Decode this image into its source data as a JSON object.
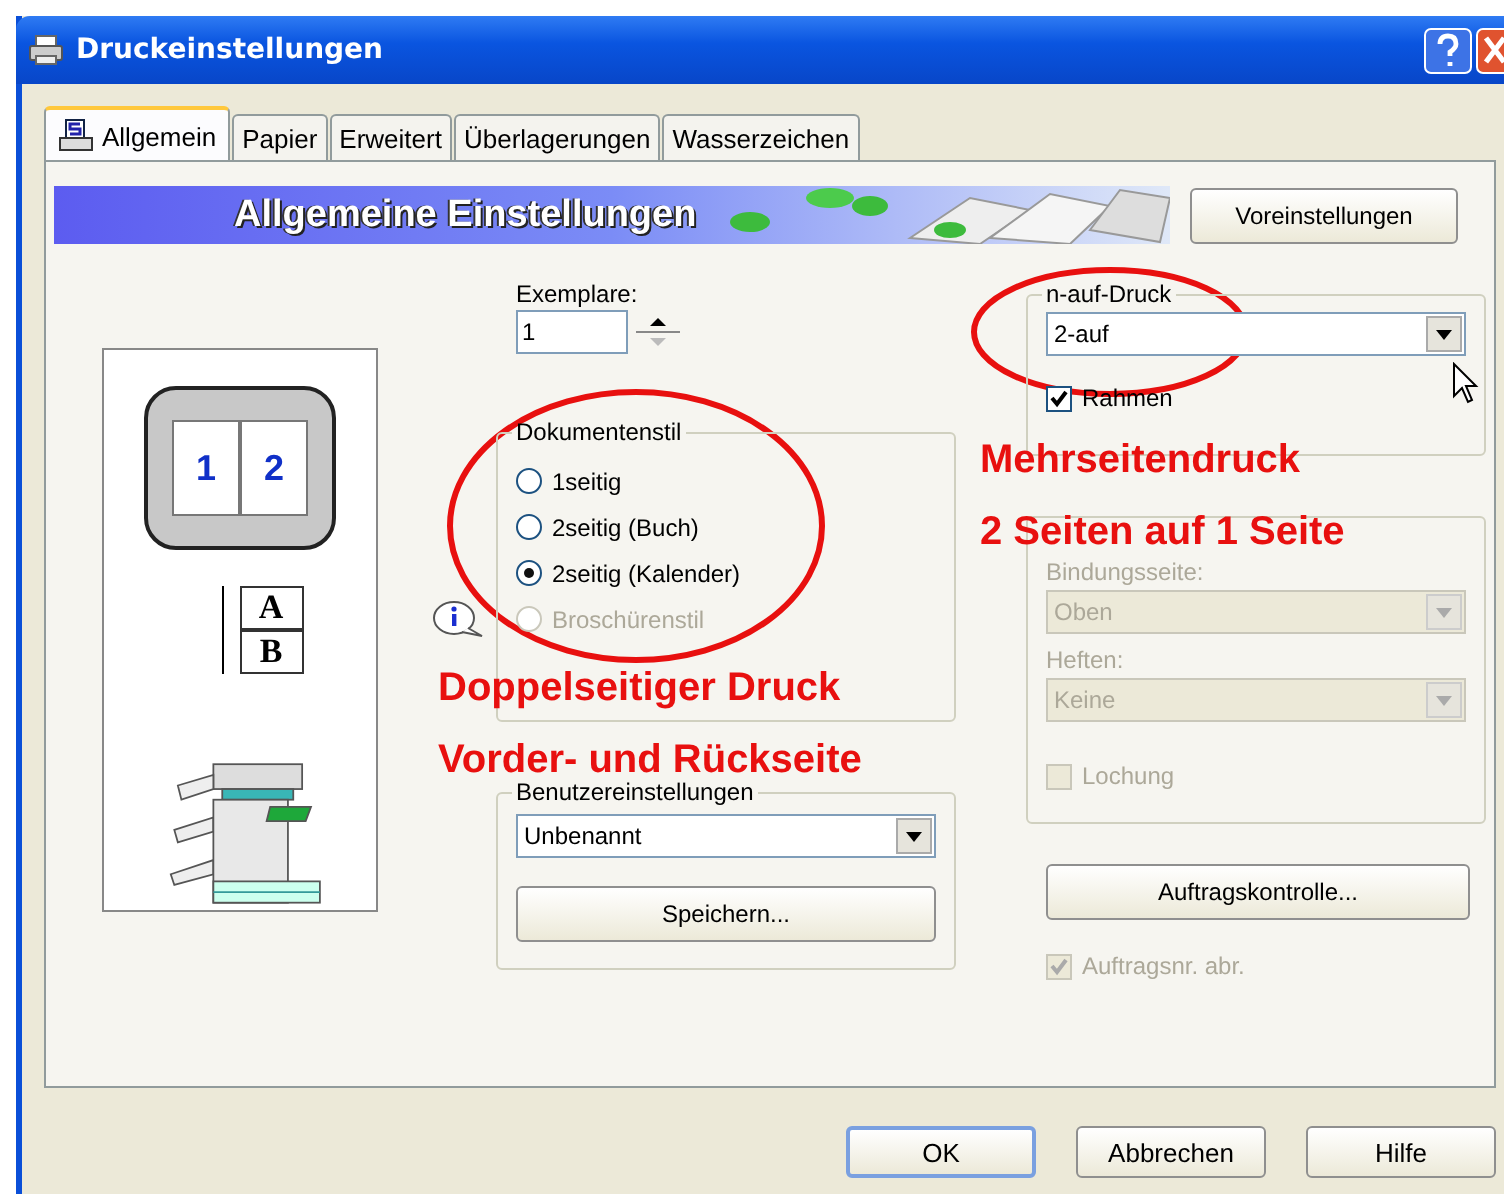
{
  "window": {
    "title": "Druckeinstellungen"
  },
  "tabs": [
    {
      "label": "Allgemein",
      "selected": true
    },
    {
      "label": "Papier",
      "selected": false
    },
    {
      "label": "Erweitert",
      "selected": false
    },
    {
      "label": "Überlagerungen",
      "selected": false
    },
    {
      "label": "Wasserzeichen",
      "selected": false
    }
  ],
  "banner": {
    "title": "Allgemeine Einstellungen"
  },
  "preset_button": "Voreinstellungen",
  "preview": {
    "pages": [
      "1",
      "2"
    ],
    "sheet_front": "A",
    "sheet_back": "B"
  },
  "copies": {
    "label": "Exemplare:",
    "value": "1"
  },
  "document_style": {
    "label": "Dokumentenstil",
    "options": [
      {
        "label": "1seitig",
        "selected": false,
        "disabled": false
      },
      {
        "label": "2seitig (Buch)",
        "selected": false,
        "disabled": false
      },
      {
        "label": "2seitig (Kalender)",
        "selected": true,
        "disabled": false
      },
      {
        "label": "Broschürenstil",
        "selected": false,
        "disabled": true
      }
    ]
  },
  "user_settings": {
    "label": "Benutzereinstellungen",
    "value": "Unbenannt",
    "save_button": "Speichern..."
  },
  "n_up": {
    "label": "n-auf-Druck",
    "value": "2-auf",
    "frame": {
      "label": "Rahmen",
      "checked": true
    }
  },
  "finishing": {
    "disabled": true,
    "fields": [
      {
        "label": "Bindungsseite:",
        "value": "Oben"
      },
      {
        "label": "Heften:",
        "value": "Keine"
      }
    ],
    "punch": {
      "label": "Lochung",
      "checked": false
    }
  },
  "job_control_button": "Auftragskontrolle...",
  "job_number": {
    "label": "Auftragsnr. abr.",
    "checked": true,
    "disabled": true
  },
  "annotations": [
    {
      "kind": "n_up",
      "lines": [
        "Mehrseitendruck",
        "2 Seiten auf 1 Seite"
      ]
    },
    {
      "kind": "duplex",
      "lines": [
        "Doppelseitiger Druck",
        "Vorder- und Rückseite"
      ]
    }
  ],
  "buttons": [
    {
      "label": "OK",
      "kind": "default"
    },
    {
      "label": "Abbrechen",
      "kind": "normal"
    },
    {
      "label": "Hilfe",
      "kind": "normal"
    }
  ]
}
